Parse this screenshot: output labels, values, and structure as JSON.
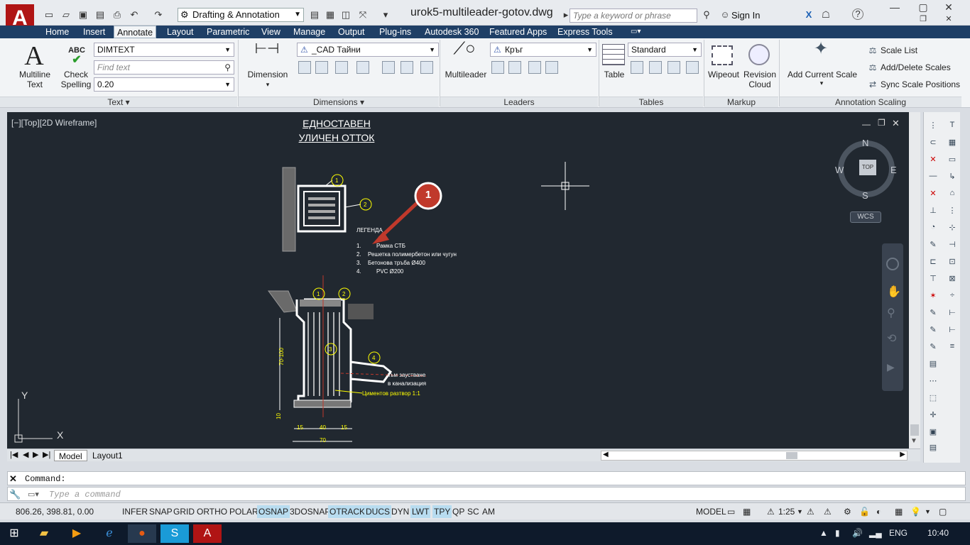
{
  "titlebar": {
    "app_logo": "A",
    "workspace": "Drafting & Annotation",
    "document": "urok5-multileader-gotov.dwg",
    "search_placeholder": "Type a keyword or phrase",
    "signin": "Sign In"
  },
  "tabs": [
    "Home",
    "Insert",
    "Annotate",
    "Layout",
    "Parametric",
    "View",
    "Manage",
    "Output",
    "Plug-ins",
    "Autodesk 360",
    "Featured Apps",
    "Express Tools"
  ],
  "active_tab": "Annotate",
  "ribbon": {
    "text_panel": {
      "multiline": "Multiline\nText",
      "multiline_l1": "Multiline",
      "multiline_l2": "Text",
      "check_abc": "ABC",
      "check_l1": "Check",
      "check_l2": "Spelling",
      "style": "DIMTEXT",
      "find_placeholder": "Find text",
      "height": "0.20",
      "title": "Text"
    },
    "dim_panel": {
      "label": "Dimension",
      "style": "_CAD Тайни",
      "title": "Dimensions"
    },
    "leader_panel": {
      "label": "Multileader",
      "style": "Кръг",
      "title": "Leaders"
    },
    "table_panel": {
      "label": "Table",
      "style": "Standard",
      "title": "Tables"
    },
    "markup_panel": {
      "wipeout": "Wipeout",
      "revision_l1": "Revision",
      "revision_l2": "Cloud",
      "title": "Markup"
    },
    "scaling_panel": {
      "add_l1": "Add Current Scale",
      "scale_list": "Scale List",
      "add_delete": "Add/Delete Scales",
      "sync": "Sync Scale Positions",
      "title": "Annotation Scaling"
    }
  },
  "viewport": {
    "label": "[−][Top][2D Wireframe]",
    "drawing_title_1": "ЕДНОСТАВЕН",
    "drawing_title_2": "УЛИЧЕН ОТТОК",
    "callout": "1",
    "legend_title": "ЛЕГЕНДА",
    "legend": [
      {
        "n": "1.",
        "t": "Рамка СТБ"
      },
      {
        "n": "2.",
        "t": "Решетка полимербетон или чугун"
      },
      {
        "n": "3.",
        "t": "Бетонова тръба Ø400"
      },
      {
        "n": "4.",
        "t": "PVC  Ø200"
      }
    ],
    "note_1": "към заустване",
    "note_2": "в канализация",
    "note_3": "Циментов разтвор 1:1",
    "dim_70_100": "70-100",
    "dim_10": "10",
    "dim_15a": "15",
    "dim_40": "40",
    "dim_15b": "15",
    "dim_70": "70",
    "marker_labels": [
      "1",
      "2",
      "1",
      "2",
      "3",
      "4"
    ],
    "compass": {
      "n": "N",
      "s": "S",
      "e": "E",
      "w": "W",
      "top": "TOP"
    },
    "wcs": "WCS"
  },
  "layout_tabs": [
    "Model",
    "Layout1"
  ],
  "command": {
    "history": "Command:",
    "placeholder": "Type a command"
  },
  "status": {
    "coords": "806.26, 398.81, 0.00",
    "toggles": [
      {
        "label": "INFER",
        "on": false
      },
      {
        "label": "SNAP",
        "on": false
      },
      {
        "label": "GRID",
        "on": false
      },
      {
        "label": "ORTHO",
        "on": false
      },
      {
        "label": "POLAR",
        "on": false
      },
      {
        "label": "OSNAP",
        "on": true
      },
      {
        "label": "3DOSNAP",
        "on": false
      },
      {
        "label": "OTRACK",
        "on": true
      },
      {
        "label": "DUCS",
        "on": true
      },
      {
        "label": "DYN",
        "on": false
      },
      {
        "label": "LWT",
        "on": true
      },
      {
        "label": "TPY",
        "on": true
      },
      {
        "label": "QP",
        "on": false
      },
      {
        "label": "SC",
        "on": false
      },
      {
        "label": "AM",
        "on": false
      }
    ],
    "model": "MODEL",
    "scale": "1:25"
  },
  "taskbar": {
    "lang": "ENG",
    "time": "10:40"
  },
  "colors": {
    "canvas": "#212830",
    "tabbar": "#1f3f66",
    "accent_red": "#c0392b",
    "status_on": "#b8dcf0"
  }
}
